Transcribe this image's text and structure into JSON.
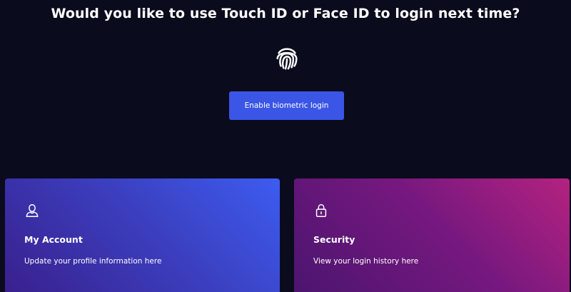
{
  "prompt": {
    "title": "Would you like to use Touch ID or Face ID to login next time?",
    "icon": "fingerprint-icon",
    "button_label": "Enable biometric login"
  },
  "colors": {
    "background": "#0b0b1e",
    "button": "#3b55e6",
    "account_card_start": "#3a1f8c",
    "account_card_end": "#3d5cf0",
    "security_card_start": "#4a156e",
    "security_card_end": "#b4227f"
  },
  "cards": [
    {
      "icon": "user-icon",
      "title": "My Account",
      "description": "Update your profile information here"
    },
    {
      "icon": "lock-icon",
      "title": "Security",
      "description": "View your login history here"
    }
  ]
}
